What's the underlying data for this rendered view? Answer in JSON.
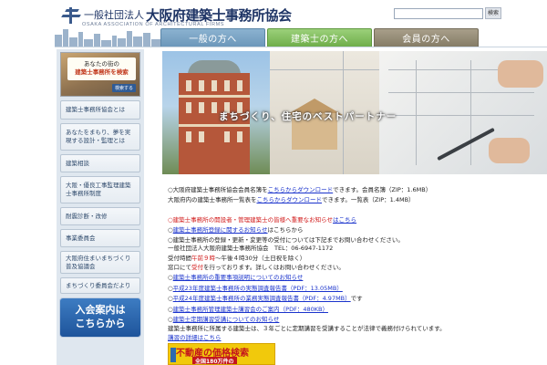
{
  "header": {
    "logo_small": "一般社団法人",
    "logo_big": "大阪府建築士事務所協会",
    "logo_sub": "OSAKA ASSOCIATION OF ARCHITECTURAL FIRMS",
    "search_placeholder": "",
    "search_button": "検索"
  },
  "nav": {
    "tabs": [
      {
        "label": "一般の方へ",
        "color": "#7aa3c4"
      },
      {
        "label": "建築士の方へ",
        "color": "#80bd5a"
      },
      {
        "label": "会員の方へ",
        "color": "#948b75"
      }
    ]
  },
  "sidebar": {
    "promo": {
      "line1": "あなたの街の",
      "line2": "建築士事務所を検索",
      "go": "検索する"
    },
    "items": [
      {
        "label": "建築士事務所協会とは"
      },
      {
        "label": "あなたをまもり、夢を実現する設計・監理とは"
      },
      {
        "label": "建築相談"
      },
      {
        "label": "大阪・優良工事監理建築士事務所制度"
      },
      {
        "label": "耐震診断・改修"
      },
      {
        "label": "事業委員会"
      },
      {
        "label": "大阪府住まいまちづくり普及協議会"
      },
      {
        "label": "まちづくり委員会だより"
      }
    ],
    "member_banner": {
      "line1": "入会案内は",
      "line2": "こちらから"
    }
  },
  "hero": {
    "tagline": "まちづくり、住宅のベストパートナー"
  },
  "content": {
    "lines": [
      {
        "pre": "○",
        "text": "大阪府建築士事務所協会会員名簿を",
        "link": "こちらからダウンロード",
        "post": "できます。会員名簿（ZIP：1.6MB）"
      },
      {
        "pre": "",
        "text": "大阪府内の建築士事務所一覧表を",
        "link": "こちらからダウンロード",
        "post": "できます。一覧表（ZIP：1.4MB）"
      },
      {
        "pre": "○",
        "text": "",
        "red": "建築士事務所の開設者・管理建築士の皆様へ重要なお知らせ",
        "link": "はこちら",
        "post": ""
      },
      {
        "pre": "○",
        "text": "",
        "link": "建築士事務所登録に関するお知らせ",
        "post": "はこちらから"
      },
      {
        "pre": "○",
        "text": "建築士事務所の登録・更新・変更等の受付については下記までお問い合わせください。",
        "link": "",
        "post": ""
      },
      {
        "pre": "",
        "text": "一般社団法人大阪府建築士事務所協会　TEL：06-6947-1172",
        "link": "",
        "post": ""
      },
      {
        "pre": "",
        "text": "受付時間",
        "red": "午前９時",
        "post": "～午後４時30分（土日祝を除く）"
      },
      {
        "pre": "",
        "text": "窓口にて",
        "red": "受付",
        "post": "を行っております。詳しくはお問い合わせください。"
      },
      {
        "pre": "○",
        "text": "",
        "link": "建築士事務所の重要事項説明についてのお知らせ",
        "post": ""
      },
      {
        "pre": "○",
        "text": "",
        "link": "平成23年度建築士事務所の実態調査報告書（PDF：13.05MB）",
        "post": ""
      },
      {
        "pre": "○",
        "text": "",
        "link": "平成24年度建築士事務所の業務実態調査報告書（PDF：4.97MB）",
        "post": "です"
      },
      {
        "pre": "○",
        "text": "",
        "link": "建築士事務所管理建築士講習会のご案内（PDF：480KB）",
        "post": ""
      },
      {
        "pre": "○",
        "text": "",
        "link": "建築士定期講習受講についてのお知らせ",
        "post": ""
      },
      {
        "pre": "",
        "text": "建築士事務所に所属する建築士は、３年ごとに定期講習を受講することが法律で義務付けられています。",
        "link": "",
        "post": ""
      },
      {
        "pre": "",
        "text": "",
        "link": "講習の詳細はこちら",
        "post": ""
      }
    ]
  },
  "price_banner": {
    "title": "不動産の価格検索",
    "sub": "全国180万件の"
  }
}
